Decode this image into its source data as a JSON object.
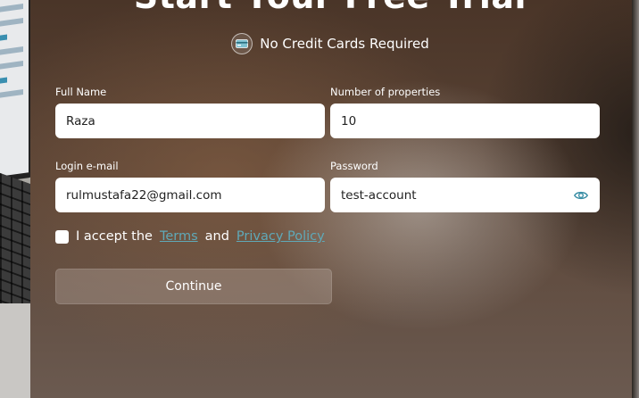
{
  "heading": "Start Your Free Trial",
  "subheading": "No Credit Cards Required",
  "icons": {
    "card": "credit-card-icon",
    "eye": "eye-icon"
  },
  "colors": {
    "link": "#5fa9b8",
    "eye": "#3b8fa6"
  },
  "form": {
    "full_name": {
      "label": "Full Name",
      "value": "Raza"
    },
    "properties": {
      "label": "Number of properties",
      "value": "10"
    },
    "email": {
      "label": "Login e-mail",
      "value": "rulmustafa22@gmail.com"
    },
    "password": {
      "label": "Password",
      "value": "test-account"
    }
  },
  "consent": {
    "prefix": "I accept the",
    "terms": "Terms",
    "and": "and",
    "privacy": "Privacy Policy",
    "checked": false
  },
  "continue_label": "Continue"
}
